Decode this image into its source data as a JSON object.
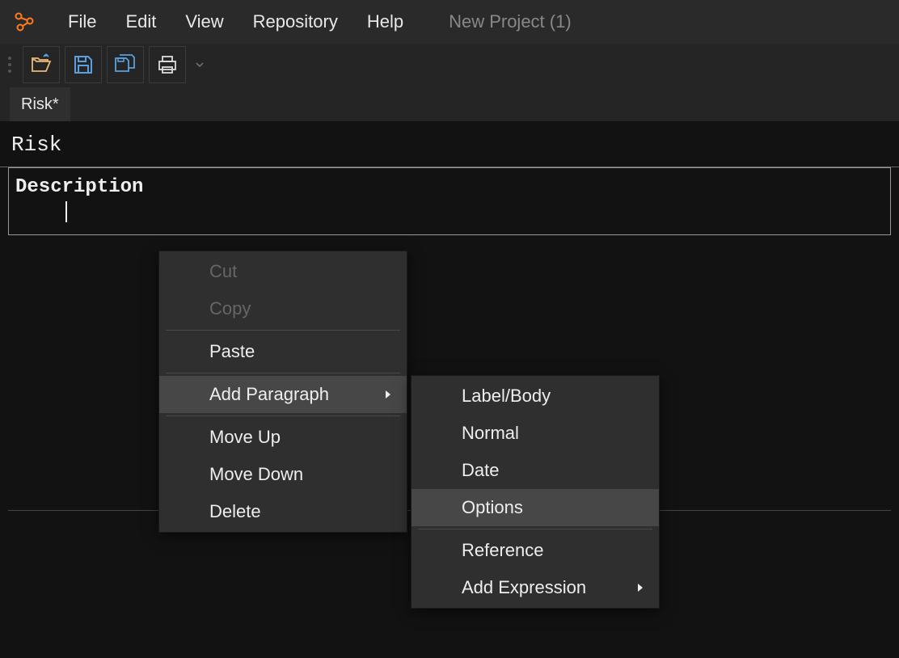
{
  "menubar": {
    "items": [
      "File",
      "Edit",
      "View",
      "Repository",
      "Help"
    ],
    "project": "New Project (1)"
  },
  "toolbar": {
    "open": "open-icon",
    "save": "save-icon",
    "save_all": "save-all-icon",
    "print": "print-icon"
  },
  "tabs": [
    {
      "label": "Risk*"
    }
  ],
  "editor": {
    "title": "Risk",
    "field_label": "Description"
  },
  "context_menu": {
    "cut": "Cut",
    "copy": "Copy",
    "paste": "Paste",
    "add_paragraph": "Add Paragraph",
    "move_up": "Move Up",
    "move_down": "Move Down",
    "delete": "Delete"
  },
  "submenu": {
    "label_body": "Label/Body",
    "normal": "Normal",
    "date": "Date",
    "options": "Options",
    "reference": "Reference",
    "add_expression": "Add Expression"
  }
}
